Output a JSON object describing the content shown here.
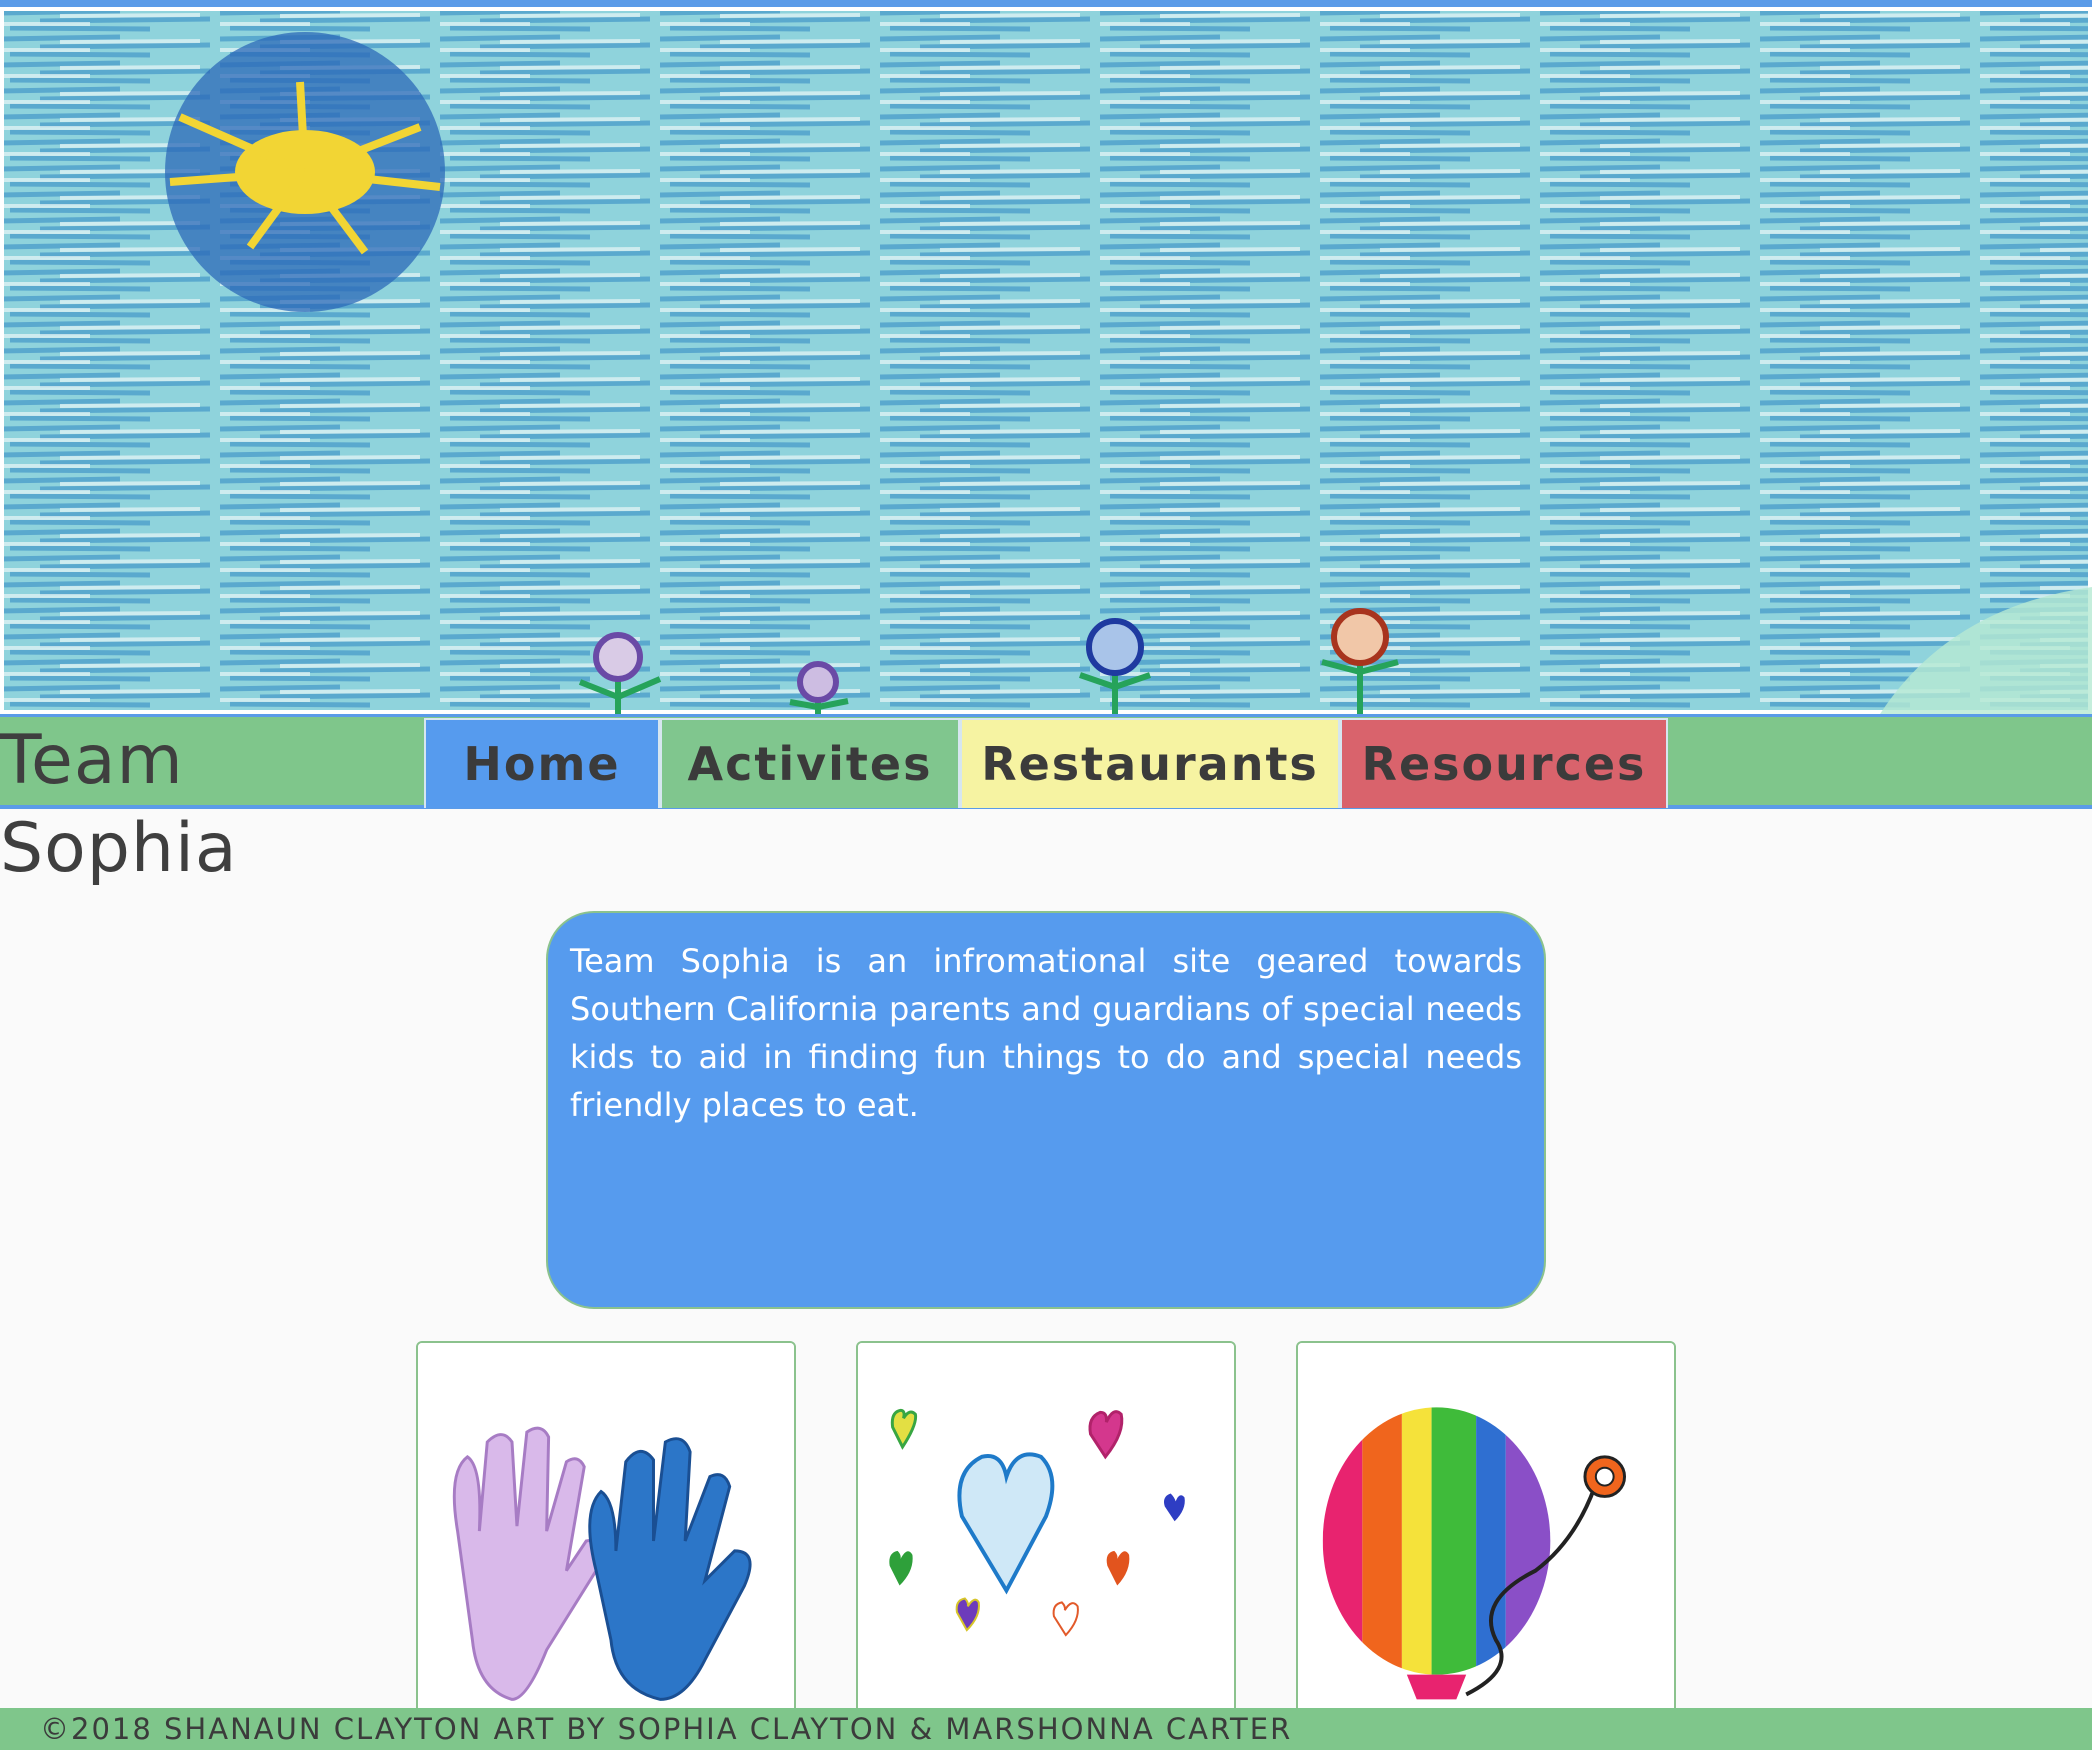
{
  "brand": "Team Sophia",
  "nav": [
    {
      "label": "Home",
      "color": "#569bee"
    },
    {
      "label": "Activites",
      "color": "#80c68e"
    },
    {
      "label": "Restaurants",
      "color": "#f6f3a2"
    },
    {
      "label": "Resources",
      "color": "#d9636c"
    }
  ],
  "intro": "Team Sophia is an infromational site geared towards Southern California parents and guardians of special needs kids to aid in finding fun things to do and special needs friendly places to eat.",
  "gallery": [
    {
      "art": "hands-drawing"
    },
    {
      "art": "hearts-drawing"
    },
    {
      "art": "rainbow-balloon-drawing"
    }
  ],
  "hero_art": "sky-sun-flowers-drawing",
  "footer": "©2018 Shanaun Clayton Art by Sophia Clayton & Marshonna Carter",
  "colors": {
    "accent_blue": "#569bee",
    "green": "#7fc68b",
    "yellow": "#f6f3a2",
    "red": "#d9636c"
  }
}
